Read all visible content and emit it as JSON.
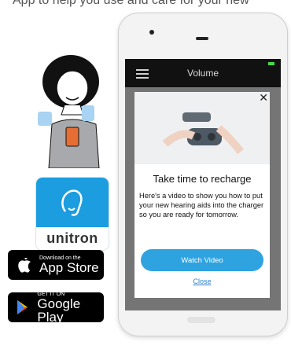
{
  "intro_text": "App to help you use and care for your new",
  "app_icon": {
    "brand": "unitron"
  },
  "badges": {
    "apple": {
      "small": "Download on the",
      "big": "App Store"
    },
    "google": {
      "small": "GET IT ON",
      "big": "Google Play"
    }
  },
  "phone": {
    "navbar": {
      "title": "Volume"
    },
    "modal": {
      "heading": "Take time to recharge",
      "body": "Here's a video to show you how to put your new hearing aids into the charger so you are ready for tomorrow.",
      "watch_label": "Watch Video",
      "close_label": "Close"
    }
  }
}
